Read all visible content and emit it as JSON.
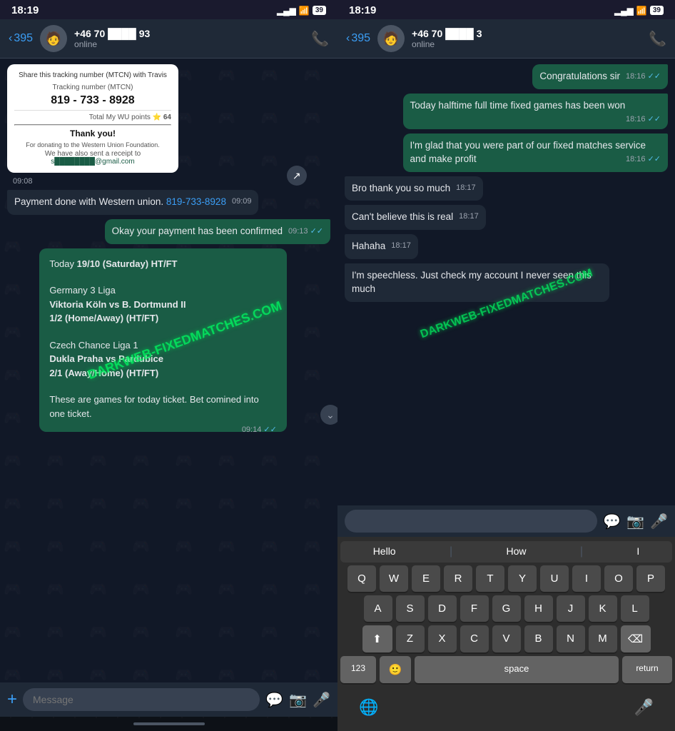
{
  "left_panel": {
    "status_bar": {
      "time": "18:19",
      "signal": "▂▄▆",
      "wifi": "WiFi",
      "battery": "39"
    },
    "header": {
      "back_label": "395",
      "contact_name": "+46 70 ████ 93",
      "status": "online",
      "call_icon": "📞"
    },
    "messages": [
      {
        "type": "received",
        "content_type": "western_union_card",
        "card": {
          "share_text": "Share this tracking number (MTCN) with Travis",
          "tracking_label": "Tracking number (MTCN)",
          "tracking_number": "819 - 733 - 8928",
          "points_label": "Total My WU points",
          "points_value": "64",
          "thank_you": "Thank you!",
          "description": "For donating to the Western Union Foundation.",
          "receipt_text": "We have also sent a receipt to",
          "email": "s████████@gmail.com"
        },
        "time": "09:08"
      },
      {
        "type": "received",
        "text": "Payment done with Western union. 819-733-8928",
        "has_link": true,
        "link_text": "819-733-8928",
        "time": "09:09"
      },
      {
        "type": "sent",
        "text": "Okay your payment has been confirmed",
        "time": "09:13",
        "ticks": true
      },
      {
        "type": "sent",
        "content_type": "game_card",
        "game": {
          "header": "Today 19/10 (Saturday) HT/FT",
          "league1": "Germany 3 Liga",
          "match1_bold": "Viktoria Köln vs B. Dortmund II",
          "result1_bold": "1/2 (Home/Away) (HT/FT)",
          "league2": "Czech Chance Liga 1",
          "match2_bold": "Dukla Praha vs Pardubice",
          "result2_bold": "2/1 (Away/Home) (HT/FT)",
          "footer": "These are games for today ticket. Bet comined into one ticket."
        },
        "time": "09:14",
        "ticks": true
      }
    ],
    "input_placeholder": "Message"
  },
  "right_panel": {
    "status_bar": {
      "time": "18:19",
      "battery": "39"
    },
    "header": {
      "back_label": "395",
      "contact_name": "+46 70 ████ 3",
      "status": "online"
    },
    "messages": [
      {
        "type": "sent",
        "text": "Congratulations sir",
        "time": "18:16",
        "ticks": true
      },
      {
        "type": "sent",
        "text": "Today halftime full time fixed games has been won",
        "time": "18:16",
        "ticks": true
      },
      {
        "type": "sent",
        "text": "I'm glad that you were part of our fixed matches service and make profit",
        "time": "18:16",
        "ticks": true
      },
      {
        "type": "received",
        "text": "Bro thank you so much",
        "time": "18:17"
      },
      {
        "type": "received",
        "text": "Can't believe this is real",
        "time": "18:17"
      },
      {
        "type": "received",
        "text": "Hahaha",
        "time": "18:17"
      },
      {
        "type": "received",
        "text": "I'm speechless. Just check my account I never seen this much",
        "time": ""
      }
    ],
    "sticker_bar": {
      "bubble_icon": "💬",
      "camera_icon": "📷",
      "mic_icon": "🎤"
    },
    "keyboard": {
      "suggestions": [
        "Hello",
        "How",
        "I"
      ],
      "rows": [
        [
          "Q",
          "W",
          "E",
          "R",
          "T",
          "Y",
          "U",
          "I",
          "O",
          "P"
        ],
        [
          "A",
          "S",
          "D",
          "F",
          "G",
          "H",
          "J",
          "K",
          "L"
        ],
        [
          "⇧",
          "Z",
          "X",
          "C",
          "V",
          "B",
          "N",
          "M",
          "⌫"
        ],
        [
          "123",
          "😊",
          "space",
          "return"
        ]
      ]
    }
  },
  "watermark": "DARKWEB-FIXEDMATCHES.COM"
}
